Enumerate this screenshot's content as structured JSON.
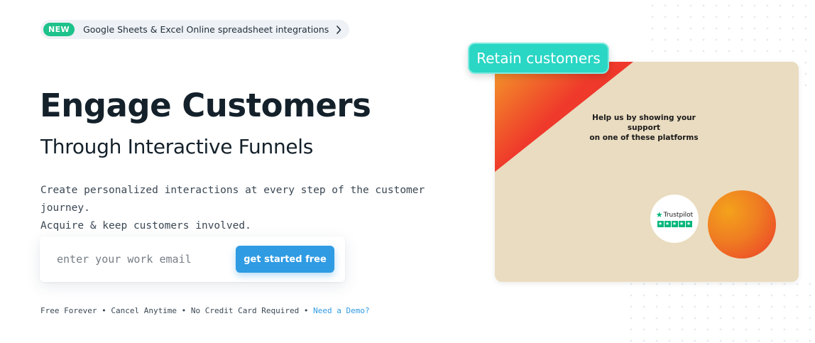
{
  "announcement": {
    "badge": "NEW",
    "text": "Google Sheets & Excel Online spreadsheet integrations",
    "chevron_icon": "chevron-right-icon"
  },
  "hero": {
    "title": "Engage Customers",
    "subtitle": "Through Interactive Funnels",
    "description_line1": "Create personalized interactions at every step of the customer journey.",
    "description_line2": "Acquire & keep customers involved."
  },
  "signup": {
    "email_placeholder": "enter your work email",
    "cta_label": "get started free"
  },
  "footnote": {
    "text": "Free Forever • Cancel Anytime • No Credit Card Required • ",
    "demo_link": "Need a Demo?"
  },
  "illustration": {
    "tag": "Retain customers",
    "support_text_line1": "Help us by showing your support",
    "support_text_line2": "on one of these platforms",
    "trustpilot_label": "Trustpilot"
  },
  "colors": {
    "accent_blue": "#2f9be3",
    "new_badge_green": "#1ec28b",
    "teal_tag": "#2ad6c4",
    "card_background": "#eadcc0"
  }
}
